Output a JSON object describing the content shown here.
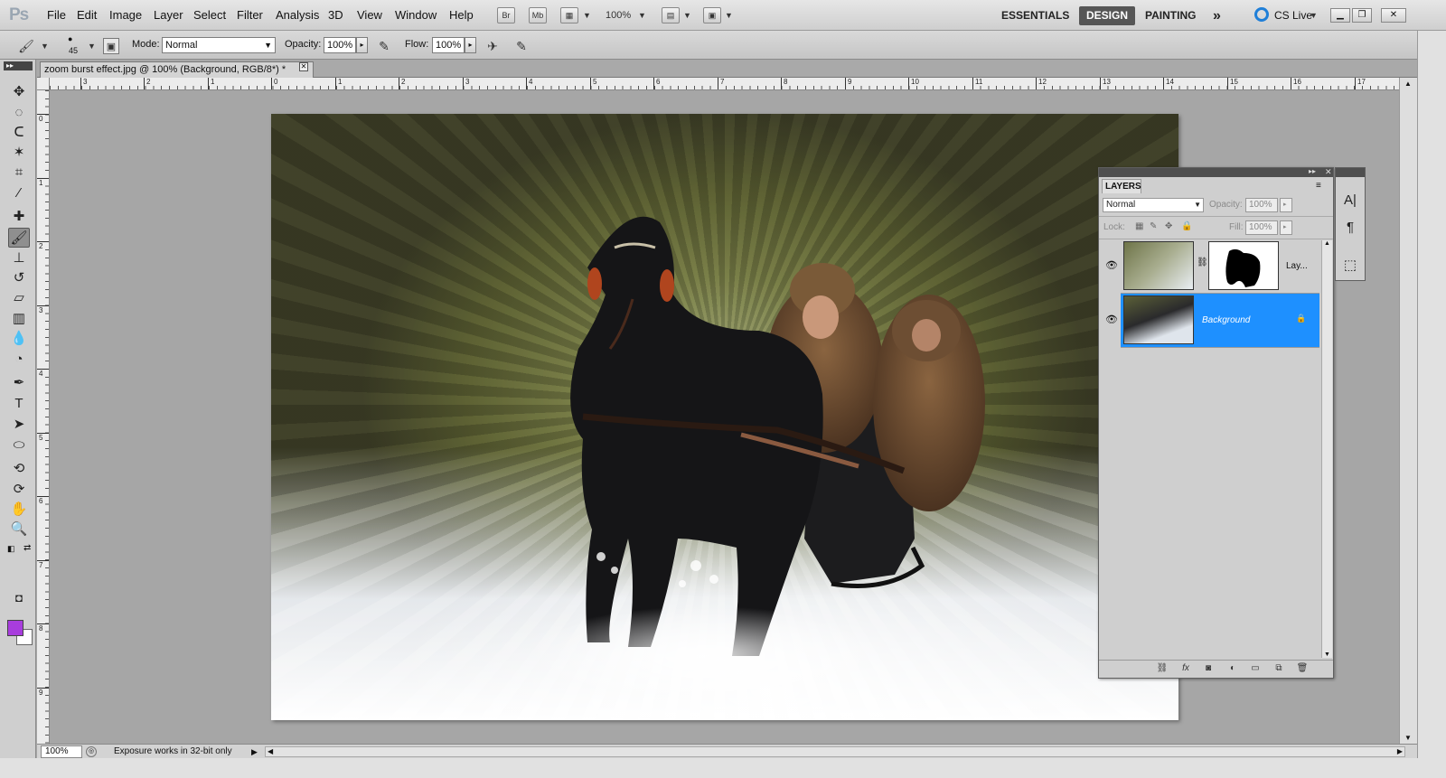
{
  "app": {
    "logo": "Ps",
    "menus": [
      "File",
      "Edit",
      "Image",
      "Layer",
      "Select",
      "Filter",
      "Analysis",
      "3D",
      "View",
      "Window",
      "Help"
    ],
    "bridge_btn": "Br",
    "minibridge_btn": "Mb",
    "zoom_level": "100%",
    "workspaces": {
      "essentials": "ESSENTIALS",
      "design": "DESIGN",
      "painting": "PAINTING",
      "more": "»"
    },
    "cs_live": "CS Live"
  },
  "options": {
    "brush_size": "45",
    "mode_label": "Mode:",
    "mode_value": "Normal",
    "opacity_label": "Opacity:",
    "opacity_value": "100%",
    "flow_label": "Flow:",
    "flow_value": "100%"
  },
  "document": {
    "tab_title": "zoom burst effect.jpg @ 100% (Background, RGB/8*) *",
    "ruler_h": [
      "3",
      "2",
      "1",
      "0",
      "1",
      "2",
      "3",
      "4",
      "5",
      "6",
      "7",
      "8",
      "9",
      "10",
      "11",
      "12",
      "13",
      "14",
      "15",
      "16",
      "17"
    ],
    "ruler_v": [
      "0",
      "1",
      "2",
      "3",
      "4",
      "5",
      "6",
      "7",
      "8",
      "9"
    ]
  },
  "status": {
    "zoom": "100%",
    "message": "Exposure works in 32-bit only"
  },
  "layers_panel": {
    "tab": "LAYERS",
    "blend_mode": "Normal",
    "opacity_label": "Opacity:",
    "opacity_value": "100%",
    "lock_label": "Lock:",
    "fill_label": "Fill:",
    "fill_value": "100%",
    "layers": [
      {
        "name": "Lay...",
        "selected": false,
        "visible": true
      },
      {
        "name": "Background",
        "selected": true,
        "visible": true,
        "locked": true
      }
    ]
  },
  "colors": {
    "foreground": "#a83ddd",
    "background": "#ffffff",
    "selection": "#1e90ff"
  }
}
